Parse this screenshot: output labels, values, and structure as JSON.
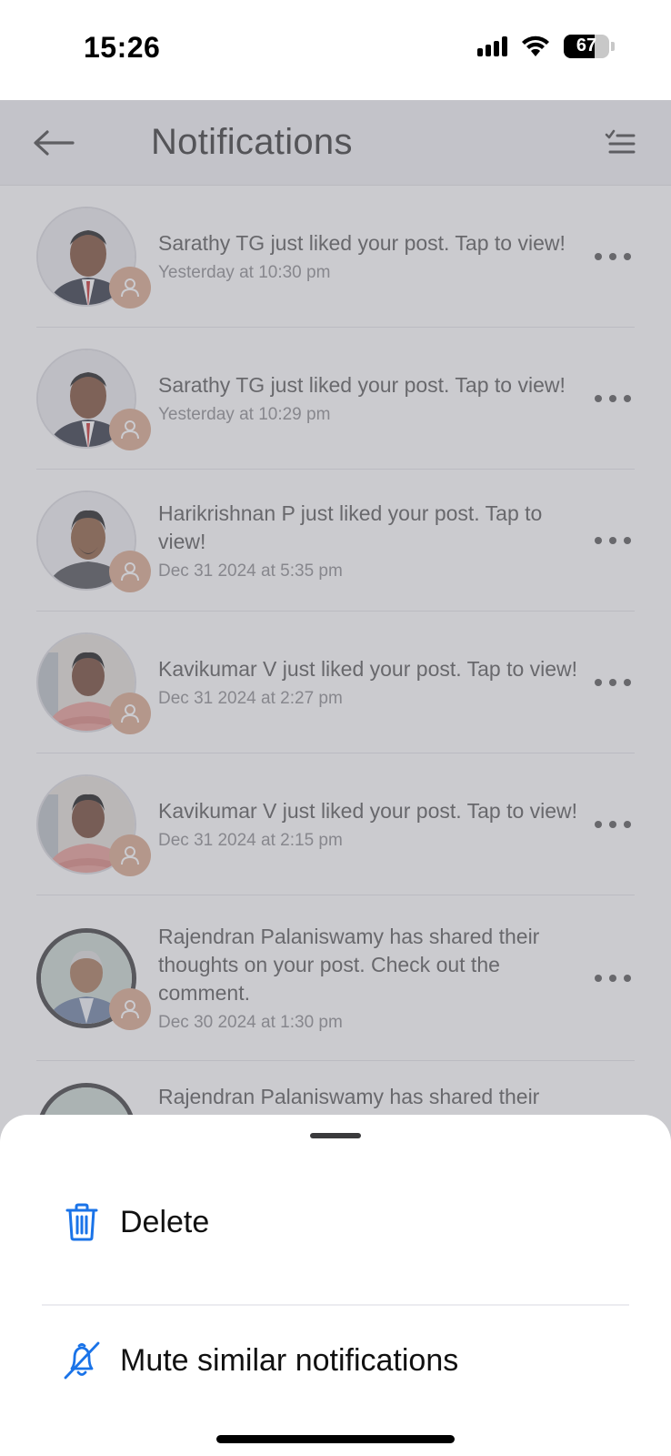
{
  "status_bar": {
    "time": "15:26",
    "battery": "67",
    "battery_level": 0.67,
    "icons": [
      "signal-icon",
      "wifi-icon",
      "battery-icon"
    ]
  },
  "header": {
    "title": "Notifications",
    "back_icon": "arrow-left-icon",
    "filter_icon": "checklist-icon"
  },
  "notifications": [
    {
      "text": "Sarathy TG just liked your post. Tap to view!",
      "time": "Yesterday at 10:30 pm",
      "avatar": "person-photo",
      "badge_icon": "user-icon"
    },
    {
      "text": "Sarathy TG just liked your post. Tap to view!",
      "time": "Yesterday at 10:29 pm",
      "avatar": "person-photo",
      "badge_icon": "user-icon"
    },
    {
      "text": "Harikrishnan P just liked your post. Tap to view!",
      "time": "Dec 31 2024 at 5:35 pm",
      "avatar": "person-photo",
      "badge_icon": "user-icon"
    },
    {
      "text": "Kavikumar V just liked your post. Tap to view!",
      "time": "Dec 31 2024 at 2:27 pm",
      "avatar": "person-photo",
      "badge_icon": "user-icon"
    },
    {
      "text": "Kavikumar V just liked your post. Tap to view!",
      "time": "Dec 31 2024 at 2:15 pm",
      "avatar": "person-photo",
      "badge_icon": "user-icon"
    },
    {
      "text": "Rajendran Palaniswamy has shared their thoughts on your post. Check out the comment.",
      "time": "Dec 30 2024 at 1:30 pm",
      "avatar": "person-photo",
      "badge_icon": "user-icon"
    },
    {
      "text": "Rajendran Palaniswamy has shared their",
      "time": "",
      "avatar": "person-photo",
      "badge_icon": "user-icon"
    }
  ],
  "sheet": {
    "options": [
      {
        "label": "Delete",
        "icon": "trash-icon"
      },
      {
        "label": "Mute similar notifications",
        "icon": "bell-off-icon"
      }
    ]
  },
  "colors": {
    "accent": "#1a73e8",
    "badge": "#d8a58a",
    "overlay": "rgba(130,130,140,0.42)"
  }
}
